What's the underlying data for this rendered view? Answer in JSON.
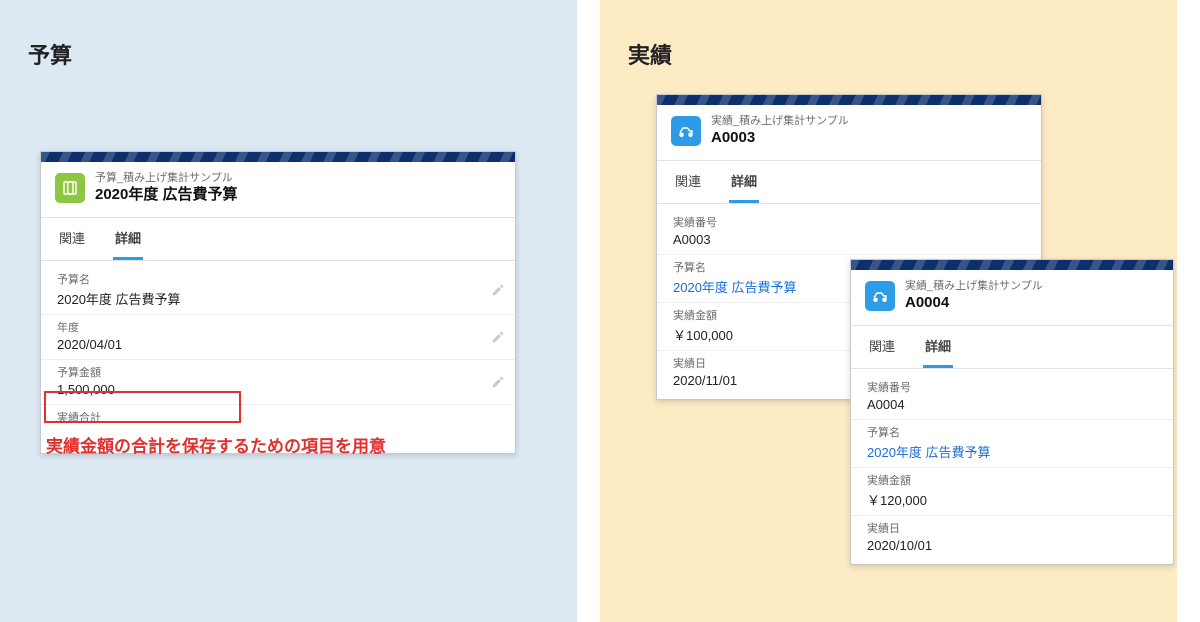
{
  "left": {
    "panel_title": "予算",
    "card": {
      "subtitle": "予算_積み上げ集計サンプル",
      "title": "2020年度 広告費予算",
      "tabs": {
        "related": "関連",
        "detail": "詳細"
      },
      "fields": {
        "name_label": "予算名",
        "name_value": "2020年度 広告費予算",
        "year_label": "年度",
        "year_value": "2020/04/01",
        "amount_label": "予算金額",
        "amount_value": "1,500,000",
        "total_label": "実績合計",
        "total_value": ""
      }
    },
    "annotation": "実績金額の合計を保存するための項目を用意"
  },
  "right": {
    "panel_title": "実績",
    "card_a": {
      "subtitle": "実績_積み上げ集計サンプル",
      "title": "A0003",
      "tabs": {
        "related": "関連",
        "detail": "詳細"
      },
      "fields": {
        "no_label": "実績番号",
        "no_value": "A0003",
        "budget_label": "予算名",
        "budget_value": "2020年度 広告費予算",
        "amount_label": "実績金額",
        "amount_value": "￥100,000",
        "date_label": "実績日",
        "date_value": "2020/11/01"
      }
    },
    "card_b": {
      "subtitle": "実績_積み上げ集計サンプル",
      "title": "A0004",
      "tabs": {
        "related": "関連",
        "detail": "詳細"
      },
      "fields": {
        "no_label": "実績番号",
        "no_value": "A0004",
        "budget_label": "予算名",
        "budget_value": "2020年度 広告費予算",
        "amount_label": "実績金額",
        "amount_value": "￥120,000",
        "date_label": "実績日",
        "date_value": "2020/10/01"
      }
    }
  }
}
